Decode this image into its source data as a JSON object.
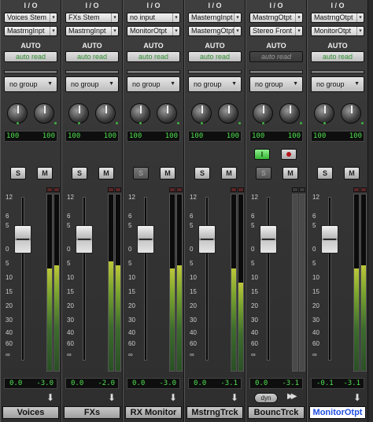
{
  "io_title": "I / O",
  "auto_title": "AUTO",
  "strips": [
    {
      "input": "Voices Stem",
      "output": "MastrngInpt",
      "auto": "auto read",
      "group": "no group",
      "pan_l": "100",
      "pan_r": "100",
      "solo": "S",
      "mute": "M",
      "vol": "0.0",
      "peak": "-3.0",
      "name": "Voices",
      "fader_db": "0",
      "meter_l": 0.58,
      "meter_r": 0.6
    },
    {
      "input": "FXs Stem",
      "output": "MastrngInpt",
      "auto": "auto read",
      "group": "no group",
      "pan_l": "100",
      "pan_r": "100",
      "solo": "S",
      "mute": "M",
      "vol": "0.0",
      "peak": "-2.0",
      "name": "FXs",
      "fader_db": "0",
      "meter_l": 0.62,
      "meter_r": 0.6
    },
    {
      "input": "no input",
      "output": "MonitorOtpt",
      "auto": "auto read",
      "group": "no group",
      "pan_l": "100",
      "pan_r": "100",
      "solo": "S",
      "mute": "M",
      "vol": "0.0",
      "peak": "-3.0",
      "name": "RX Monitor",
      "fader_db": "0",
      "meter_l": 0.58,
      "meter_r": 0.6
    },
    {
      "input": "MasterngInpt",
      "output": "MasterngOtpt",
      "auto": "auto read",
      "group": "no group",
      "pan_l": "100",
      "pan_r": "100",
      "solo": "S",
      "mute": "M",
      "vol": "0.0",
      "peak": "-3.1",
      "name": "MstrngTrck",
      "fader_db": "0",
      "meter_l": 0.58,
      "meter_r": 0.5
    },
    {
      "input": "MastrngOtpt",
      "output": "Stereo Front",
      "auto": "auto read",
      "group": "no group",
      "pan_l": "100",
      "pan_r": "100",
      "input_btn": "I",
      "solo": "S",
      "mute": "M",
      "vol": "0.0",
      "peak": "-3.1",
      "name": "BouncTrck",
      "fader_db": "0",
      "dyn": "dyn",
      "meter_l": 0,
      "meter_r": 0
    },
    {
      "input": "MastrngOtpt",
      "output": "MonitorOtpt",
      "auto": "auto read",
      "group": "no group",
      "pan_l": "100",
      "pan_r": "100",
      "solo": "S",
      "mute": "M",
      "vol": "-0.1",
      "peak": "-3.1",
      "name": "MonitorOtpt",
      "fader_db": "-0.1",
      "meter_l": 0.58,
      "meter_r": 0.6
    }
  ],
  "scale_marks": [
    "12",
    "6",
    "5",
    "0",
    "5",
    "10",
    "15",
    "20",
    "30",
    "40",
    "60",
    "∞"
  ]
}
